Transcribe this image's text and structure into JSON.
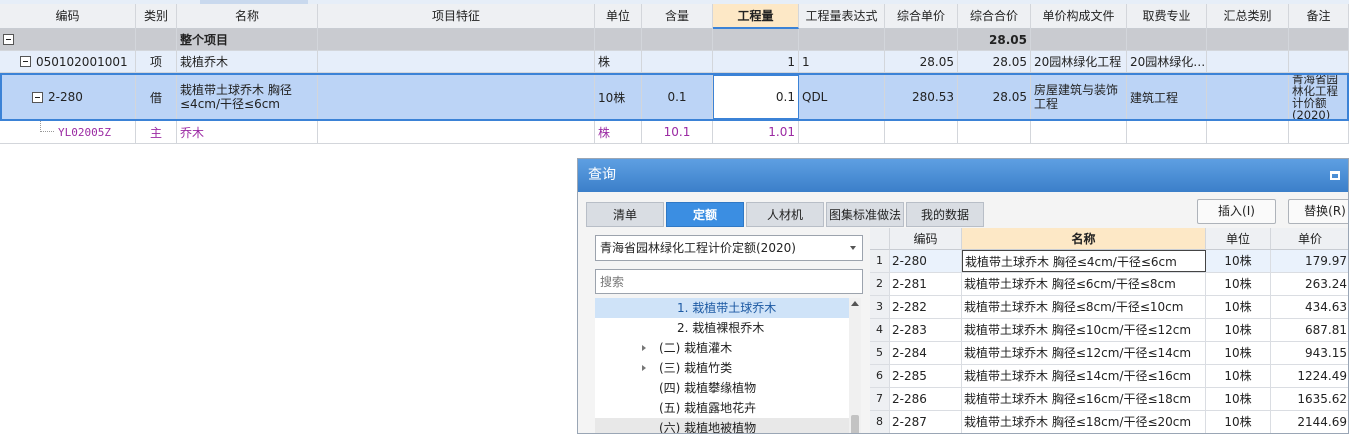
{
  "main_grid": {
    "headers": [
      "编码",
      "类别",
      "名称",
      "项目特征",
      "单位",
      "含量",
      "工程量",
      "工程量表达式",
      "综合单价",
      "综合合价",
      "单价构成文件",
      "取费专业",
      "汇总类别",
      "备注"
    ],
    "rows": [
      {
        "code": "",
        "type": "",
        "name": "整个项目",
        "feature": "",
        "unit": "",
        "content": "",
        "qty": "",
        "expr": "",
        "unit_price": "",
        "total": "28.05",
        "price_file": "",
        "fee_type": "",
        "summary": "",
        "remark": ""
      },
      {
        "code": "050102001001",
        "type": "项",
        "name": "栽植乔木",
        "feature": "",
        "unit": "株",
        "content": "",
        "qty": "1",
        "expr": "1",
        "unit_price": "28.05",
        "total": "28.05",
        "price_file": "20园林绿化工程",
        "fee_type": "20园林绿化…",
        "summary": "",
        "remark": ""
      },
      {
        "code": "2-280",
        "type": "借",
        "name": "栽植带土球乔木 胸径≤4cm/干径≤6cm",
        "feature": "",
        "unit": "10株",
        "content": "0.1",
        "qty": "0.1",
        "expr": "QDL",
        "unit_price": "280.53",
        "total": "28.05",
        "price_file": "房屋建筑与装饰工程",
        "fee_type": "建筑工程",
        "summary": "",
        "remark": "青海省园林化工程计价额(2020)"
      },
      {
        "code": "YL02005Z",
        "type": "主",
        "name": "乔木",
        "feature": "",
        "unit": "株",
        "content": "10.1",
        "qty": "1.01",
        "expr": "",
        "unit_price": "",
        "total": "",
        "price_file": "",
        "fee_type": "",
        "summary": "",
        "remark": ""
      }
    ]
  },
  "dialog": {
    "title": "查询",
    "tabs": [
      "清单",
      "定额",
      "人材机",
      "图集标准做法",
      "我的数据"
    ],
    "active_tab": 1,
    "insert_button": "插入(I)",
    "replace_button": "替换(R)",
    "library": "青海省园林绿化工程计价定额(2020)",
    "search_placeholder": "搜索",
    "tree": [
      {
        "label": "1. 栽植带土球乔木",
        "level": 2,
        "expandable": false,
        "selected": true
      },
      {
        "label": "2. 栽植裸根乔木",
        "level": 2,
        "expandable": false,
        "selected": false
      },
      {
        "label": "(二) 栽植灌木",
        "level": 1,
        "expandable": true,
        "selected": false
      },
      {
        "label": "(三) 栽植竹类",
        "level": 1,
        "expandable": true,
        "selected": false
      },
      {
        "label": "(四) 栽植攀缘植物",
        "level": 1,
        "expandable": false,
        "selected": false
      },
      {
        "label": "(五) 栽植露地花卉",
        "level": 1,
        "expandable": false,
        "selected": false
      },
      {
        "label": "(六) 栽植地被植物",
        "level": 1,
        "expandable": false,
        "selected": false
      }
    ],
    "grid_headers": [
      "",
      "编码",
      "名称",
      "单位",
      "单价"
    ],
    "grid_rows": [
      {
        "num": "1",
        "code": "2-280",
        "name": "栽植带土球乔木 胸径≤4cm/干径≤6cm",
        "unit": "10株",
        "price": "179.97"
      },
      {
        "num": "2",
        "code": "2-281",
        "name": "栽植带土球乔木 胸径≤6cm/干径≤8cm",
        "unit": "10株",
        "price": "263.24"
      },
      {
        "num": "3",
        "code": "2-282",
        "name": "栽植带土球乔木 胸径≤8cm/干径≤10cm",
        "unit": "10株",
        "price": "434.63"
      },
      {
        "num": "4",
        "code": "2-283",
        "name": "栽植带土球乔木 胸径≤10cm/干径≤12cm",
        "unit": "10株",
        "price": "687.81"
      },
      {
        "num": "5",
        "code": "2-284",
        "name": "栽植带土球乔木 胸径≤12cm/干径≤14cm",
        "unit": "10株",
        "price": "943.15"
      },
      {
        "num": "6",
        "code": "2-285",
        "name": "栽植带土球乔木 胸径≤14cm/干径≤16cm",
        "unit": "10株",
        "price": "1224.49"
      },
      {
        "num": "7",
        "code": "2-286",
        "name": "栽植带土球乔木 胸径≤16cm/干径≤18cm",
        "unit": "10株",
        "price": "1635.62"
      },
      {
        "num": "8",
        "code": "2-287",
        "name": "栽植带土球乔木 胸径≤18cm/干径≤20cm",
        "unit": "10株",
        "price": "2144.69"
      }
    ]
  },
  "colors": {
    "accent": "#3b8ee2",
    "header_active": "#fde8c6",
    "selected_row": "#bcd4f6",
    "material_text": "#9b2aa3"
  }
}
